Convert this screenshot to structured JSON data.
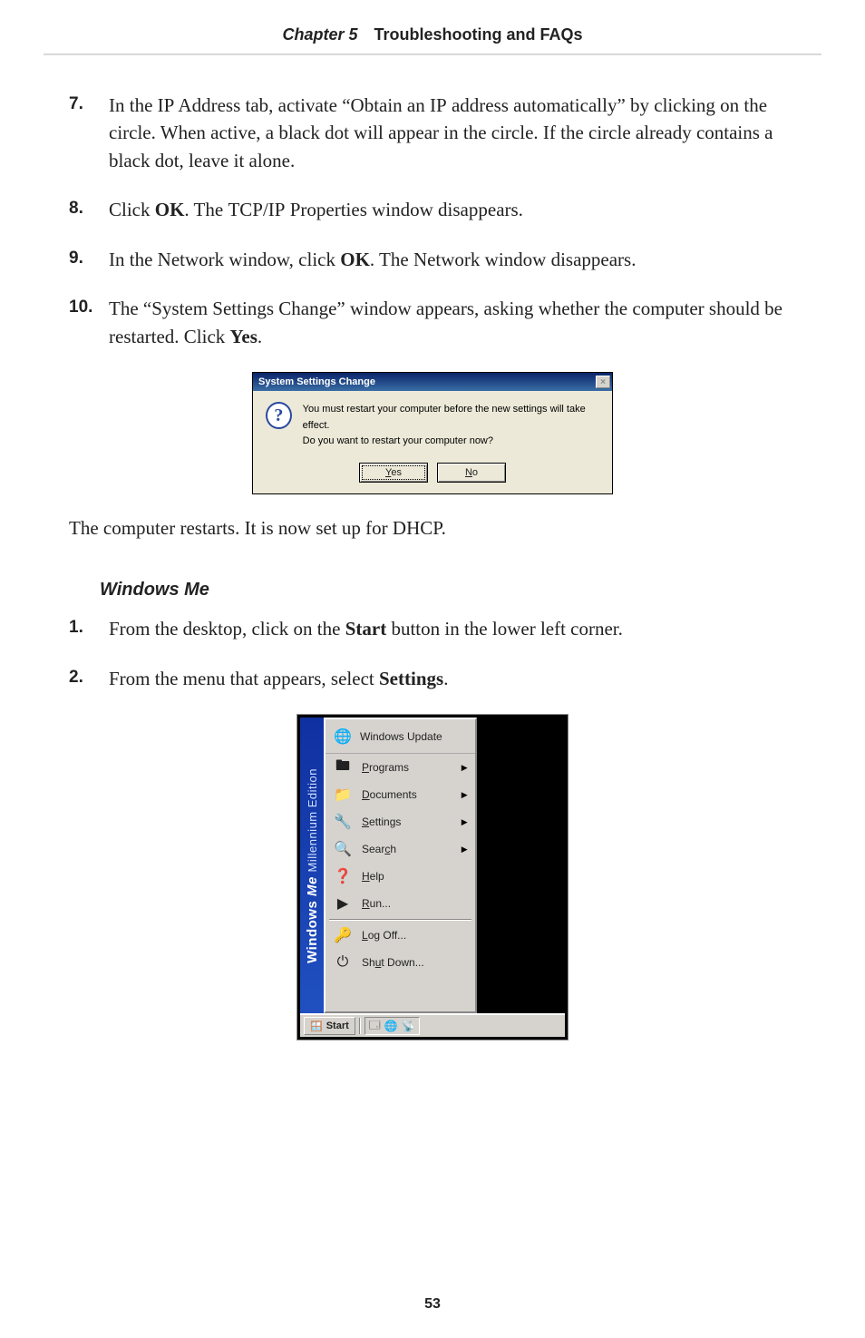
{
  "header": {
    "chapter": "Chapter 5",
    "title": "Troubleshooting and FAQs"
  },
  "stepsA": [
    {
      "n": "7.",
      "pre": "In the ",
      "sc1": "IP",
      "mid1": " Address tab, activate “Obtain an ",
      "sc2": "IP",
      "mid2": " address automatically” by clicking on the circle. When active, a black dot will appear in the circle. If the circle already contains a black dot, leave it alone."
    },
    {
      "n": "8.",
      "pre": "Click ",
      "b1": "OK",
      "mid1": ". The ",
      "sc1": "TCP/IP",
      "post": " Properties window disappears."
    },
    {
      "n": "9.",
      "pre": "In the Network window, click ",
      "b1": "OK",
      "post": ". The Network window disappears."
    },
    {
      "n": "10.",
      "pre": "The “System Settings Change” window appears, asking whether the computer should be restarted. Click ",
      "b1": "Yes",
      "post": "."
    }
  ],
  "dialog": {
    "title": "System Settings Change",
    "line1": "You must restart your computer before the new settings will take effect.",
    "line2": "Do you want to restart your computer now?",
    "yes_pre": "",
    "yes_u": "Y",
    "yes_post": "es",
    "no_pre": "",
    "no_u": "N",
    "no_post": "o"
  },
  "para1": "The computer restarts. It is now set up for DHCP.",
  "subhead": "Windows Me",
  "stepsB": [
    {
      "n": "1.",
      "pre": "From the desktop, click on the ",
      "b1": "Start",
      "post": " button in the lower left corner."
    },
    {
      "n": "2.",
      "pre": "From the menu that appears, select ",
      "b1": "Settings",
      "post": "."
    }
  ],
  "startmenu": {
    "stripe_brand": "Windows",
    "stripe_me": "Me",
    "stripe_edition": "Millennium Edition",
    "top": "Windows Update",
    "items": [
      {
        "u": "P",
        "rest": "rograms",
        "arrow": true,
        "icon": "🖿"
      },
      {
        "u": "D",
        "rest": "ocuments",
        "arrow": true,
        "icon": "📁"
      },
      {
        "u": "S",
        "rest": "ettings",
        "arrow": true,
        "icon": "🔧"
      },
      {
        "pre": "Sear",
        "u": "c",
        "rest": "h",
        "arrow": true,
        "icon": "🔍"
      },
      {
        "u": "H",
        "rest": "elp",
        "icon": "❓"
      },
      {
        "u": "R",
        "rest": "un...",
        "icon": "▶"
      }
    ],
    "items2": [
      {
        "u": "L",
        "rest": "og Off...",
        "icon": "🔑"
      },
      {
        "pre": "Sh",
        "u": "u",
        "rest": "t Down...",
        "icon": "⏻"
      }
    ],
    "start_label": "Start",
    "tray_icons": [
      "🗔",
      "🌐",
      "📡"
    ]
  },
  "page_number": "53"
}
